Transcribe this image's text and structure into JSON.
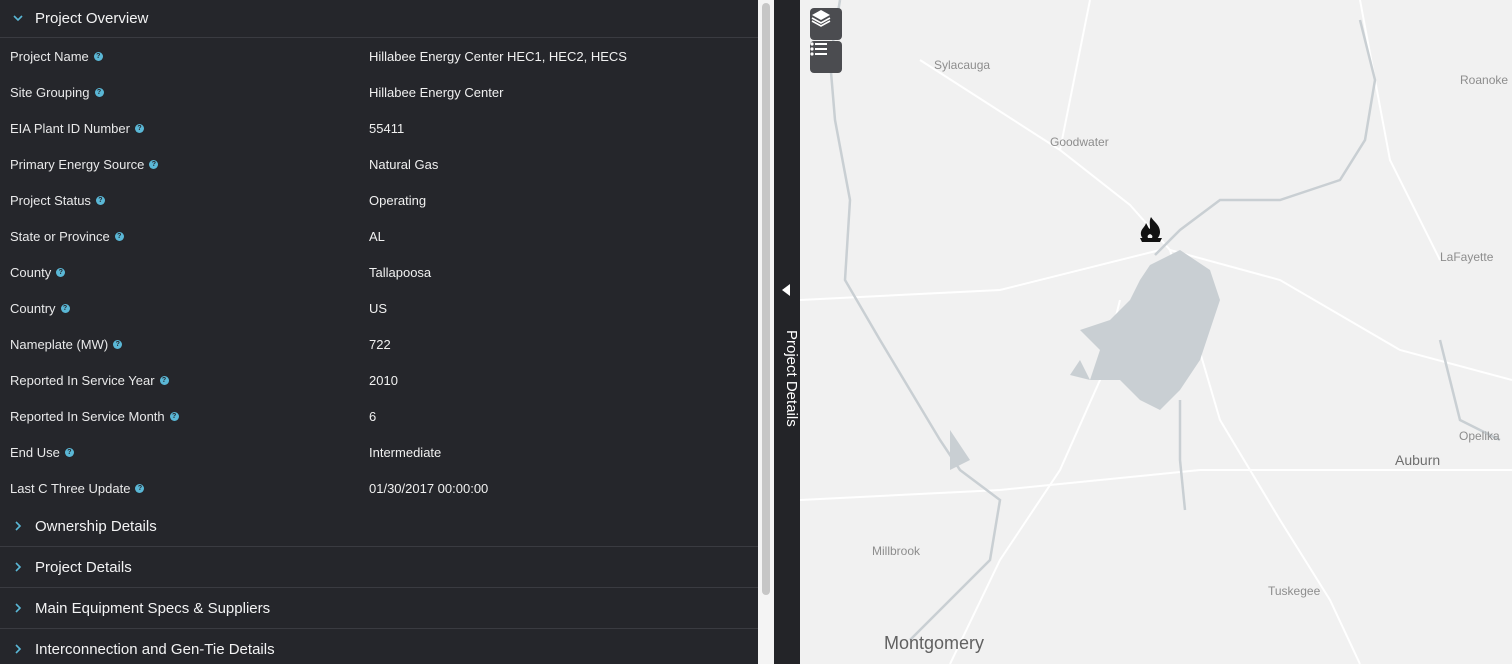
{
  "overview": {
    "title": "Project Overview",
    "rows": [
      {
        "label": "Project Name",
        "value": "Hillabee Energy Center HEC1, HEC2, HECS"
      },
      {
        "label": "Site Grouping",
        "value": "Hillabee Energy Center"
      },
      {
        "label": "EIA Plant ID Number",
        "value": "55411"
      },
      {
        "label": "Primary Energy Source",
        "value": "Natural Gas"
      },
      {
        "label": "Project Status",
        "value": "Operating"
      },
      {
        "label": "State or Province",
        "value": "AL"
      },
      {
        "label": "County",
        "value": "Tallapoosa"
      },
      {
        "label": "Country",
        "value": "US"
      },
      {
        "label": "Nameplate (MW)",
        "value": "722"
      },
      {
        "label": "Reported In Service Year",
        "value": "2010"
      },
      {
        "label": "Reported In Service Month",
        "value": "6"
      },
      {
        "label": "End Use",
        "value": "Intermediate"
      },
      {
        "label": "Last C Three Update",
        "value": "01/30/2017 00:00:00"
      }
    ]
  },
  "sections": [
    {
      "title": "Ownership Details"
    },
    {
      "title": "Project Details"
    },
    {
      "title": "Main Equipment Specs & Suppliers"
    },
    {
      "title": "Interconnection and Gen-Tie Details"
    }
  ],
  "side_tab": {
    "label": "Project Details"
  },
  "map": {
    "cities": [
      "Sylacauga",
      "Roanoke",
      "Goodwater",
      "LaFayette",
      "Opelika",
      "Auburn",
      "Millbrook",
      "Tuskegee",
      "Montgomery"
    ],
    "marker_icon": "natural-gas-flame-icon",
    "buttons": [
      "layers-icon",
      "legend-list-icon"
    ],
    "water_color": "#c9cfd3",
    "land_color": "#f1f1f1"
  },
  "colors": {
    "panel_bg": "#25262b",
    "accent": "#5ab7d6"
  }
}
